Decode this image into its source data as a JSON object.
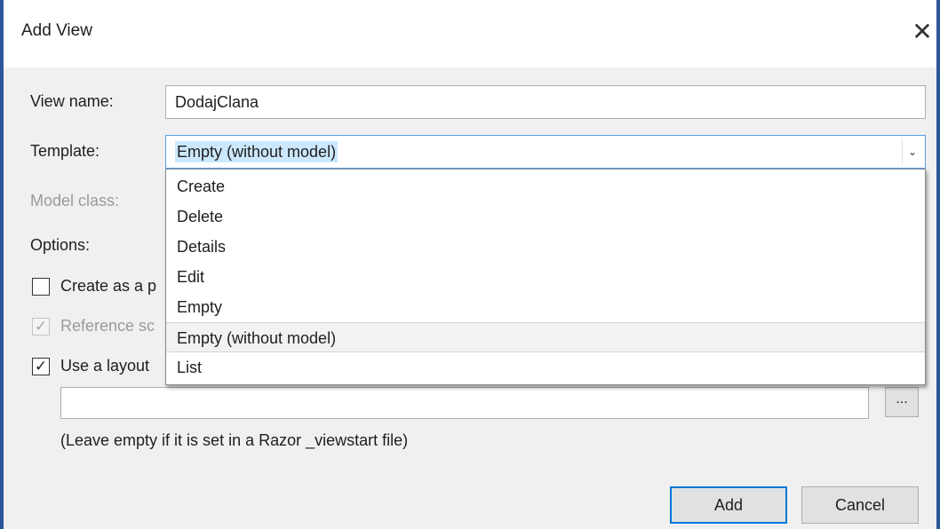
{
  "dialog": {
    "title": "Add View",
    "close_glyph": "✕"
  },
  "form": {
    "view_name_label": "View name:",
    "view_name_value": "DodajClana",
    "template_label": "Template:",
    "template_value": "Empty (without model)",
    "template_arrow": "⌄",
    "model_class_label": "Model class:",
    "options_label": "Options:",
    "partial_label": "Create as a p",
    "partial_checked": false,
    "ref_scripts_label": "Reference sc",
    "ref_scripts_checked": true,
    "layout_label": "Use a layout",
    "layout_checked": true,
    "check_glyph": "✓",
    "layout_path_value": "",
    "browse_label": "...",
    "hint": "(Leave empty if it is set in a Razor _viewstart file)"
  },
  "template_options": [
    "Create",
    "Delete",
    "Details",
    "Edit",
    "Empty",
    "Empty (without model)",
    "List"
  ],
  "template_highlighted_index": 5,
  "buttons": {
    "add": "Add",
    "cancel": "Cancel"
  },
  "colors": {
    "accent": "#2b579a",
    "selection": "#cce8ff",
    "focus_border": "#569de5",
    "default_button_border": "#0078d7"
  },
  "icons": {
    "close": "close-icon",
    "dropdown": "chevron-down-icon",
    "check": "checkmark-icon"
  }
}
